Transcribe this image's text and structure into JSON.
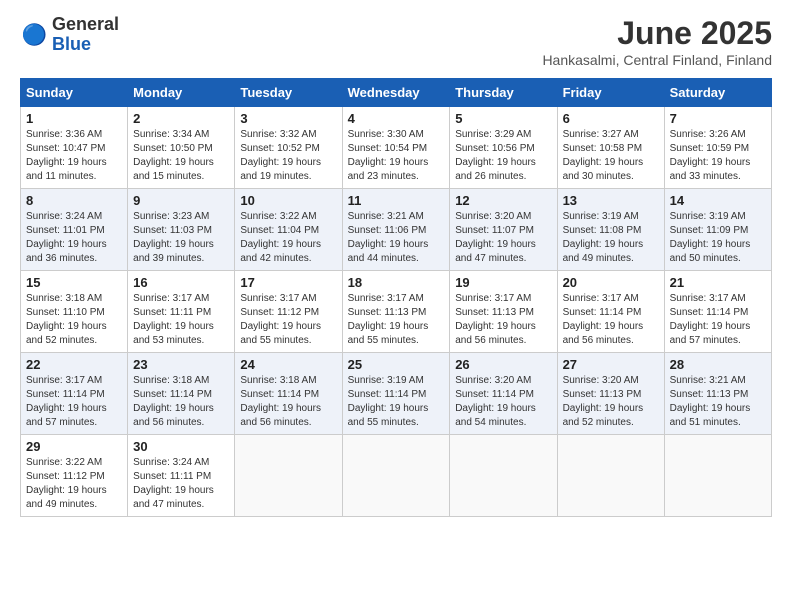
{
  "logo": {
    "general": "General",
    "blue": "Blue"
  },
  "title": "June 2025",
  "location": "Hankasalmi, Central Finland, Finland",
  "weekdays": [
    "Sunday",
    "Monday",
    "Tuesday",
    "Wednesday",
    "Thursday",
    "Friday",
    "Saturday"
  ],
  "weeks": [
    [
      {
        "day": "1",
        "sunrise": "Sunrise: 3:36 AM",
        "sunset": "Sunset: 10:47 PM",
        "daylight": "Daylight: 19 hours and 11 minutes."
      },
      {
        "day": "2",
        "sunrise": "Sunrise: 3:34 AM",
        "sunset": "Sunset: 10:50 PM",
        "daylight": "Daylight: 19 hours and 15 minutes."
      },
      {
        "day": "3",
        "sunrise": "Sunrise: 3:32 AM",
        "sunset": "Sunset: 10:52 PM",
        "daylight": "Daylight: 19 hours and 19 minutes."
      },
      {
        "day": "4",
        "sunrise": "Sunrise: 3:30 AM",
        "sunset": "Sunset: 10:54 PM",
        "daylight": "Daylight: 19 hours and 23 minutes."
      },
      {
        "day": "5",
        "sunrise": "Sunrise: 3:29 AM",
        "sunset": "Sunset: 10:56 PM",
        "daylight": "Daylight: 19 hours and 26 minutes."
      },
      {
        "day": "6",
        "sunrise": "Sunrise: 3:27 AM",
        "sunset": "Sunset: 10:58 PM",
        "daylight": "Daylight: 19 hours and 30 minutes."
      },
      {
        "day": "7",
        "sunrise": "Sunrise: 3:26 AM",
        "sunset": "Sunset: 10:59 PM",
        "daylight": "Daylight: 19 hours and 33 minutes."
      }
    ],
    [
      {
        "day": "8",
        "sunrise": "Sunrise: 3:24 AM",
        "sunset": "Sunset: 11:01 PM",
        "daylight": "Daylight: 19 hours and 36 minutes."
      },
      {
        "day": "9",
        "sunrise": "Sunrise: 3:23 AM",
        "sunset": "Sunset: 11:03 PM",
        "daylight": "Daylight: 19 hours and 39 minutes."
      },
      {
        "day": "10",
        "sunrise": "Sunrise: 3:22 AM",
        "sunset": "Sunset: 11:04 PM",
        "daylight": "Daylight: 19 hours and 42 minutes."
      },
      {
        "day": "11",
        "sunrise": "Sunrise: 3:21 AM",
        "sunset": "Sunset: 11:06 PM",
        "daylight": "Daylight: 19 hours and 44 minutes."
      },
      {
        "day": "12",
        "sunrise": "Sunrise: 3:20 AM",
        "sunset": "Sunset: 11:07 PM",
        "daylight": "Daylight: 19 hours and 47 minutes."
      },
      {
        "day": "13",
        "sunrise": "Sunrise: 3:19 AM",
        "sunset": "Sunset: 11:08 PM",
        "daylight": "Daylight: 19 hours and 49 minutes."
      },
      {
        "day": "14",
        "sunrise": "Sunrise: 3:19 AM",
        "sunset": "Sunset: 11:09 PM",
        "daylight": "Daylight: 19 hours and 50 minutes."
      }
    ],
    [
      {
        "day": "15",
        "sunrise": "Sunrise: 3:18 AM",
        "sunset": "Sunset: 11:10 PM",
        "daylight": "Daylight: 19 hours and 52 minutes."
      },
      {
        "day": "16",
        "sunrise": "Sunrise: 3:17 AM",
        "sunset": "Sunset: 11:11 PM",
        "daylight": "Daylight: 19 hours and 53 minutes."
      },
      {
        "day": "17",
        "sunrise": "Sunrise: 3:17 AM",
        "sunset": "Sunset: 11:12 PM",
        "daylight": "Daylight: 19 hours and 55 minutes."
      },
      {
        "day": "18",
        "sunrise": "Sunrise: 3:17 AM",
        "sunset": "Sunset: 11:13 PM",
        "daylight": "Daylight: 19 hours and 55 minutes."
      },
      {
        "day": "19",
        "sunrise": "Sunrise: 3:17 AM",
        "sunset": "Sunset: 11:13 PM",
        "daylight": "Daylight: 19 hours and 56 minutes."
      },
      {
        "day": "20",
        "sunrise": "Sunrise: 3:17 AM",
        "sunset": "Sunset: 11:14 PM",
        "daylight": "Daylight: 19 hours and 56 minutes."
      },
      {
        "day": "21",
        "sunrise": "Sunrise: 3:17 AM",
        "sunset": "Sunset: 11:14 PM",
        "daylight": "Daylight: 19 hours and 57 minutes."
      }
    ],
    [
      {
        "day": "22",
        "sunrise": "Sunrise: 3:17 AM",
        "sunset": "Sunset: 11:14 PM",
        "daylight": "Daylight: 19 hours and 57 minutes."
      },
      {
        "day": "23",
        "sunrise": "Sunrise: 3:18 AM",
        "sunset": "Sunset: 11:14 PM",
        "daylight": "Daylight: 19 hours and 56 minutes."
      },
      {
        "day": "24",
        "sunrise": "Sunrise: 3:18 AM",
        "sunset": "Sunset: 11:14 PM",
        "daylight": "Daylight: 19 hours and 56 minutes."
      },
      {
        "day": "25",
        "sunrise": "Sunrise: 3:19 AM",
        "sunset": "Sunset: 11:14 PM",
        "daylight": "Daylight: 19 hours and 55 minutes."
      },
      {
        "day": "26",
        "sunrise": "Sunrise: 3:20 AM",
        "sunset": "Sunset: 11:14 PM",
        "daylight": "Daylight: 19 hours and 54 minutes."
      },
      {
        "day": "27",
        "sunrise": "Sunrise: 3:20 AM",
        "sunset": "Sunset: 11:13 PM",
        "daylight": "Daylight: 19 hours and 52 minutes."
      },
      {
        "day": "28",
        "sunrise": "Sunrise: 3:21 AM",
        "sunset": "Sunset: 11:13 PM",
        "daylight": "Daylight: 19 hours and 51 minutes."
      }
    ],
    [
      {
        "day": "29",
        "sunrise": "Sunrise: 3:22 AM",
        "sunset": "Sunset: 11:12 PM",
        "daylight": "Daylight: 19 hours and 49 minutes."
      },
      {
        "day": "30",
        "sunrise": "Sunrise: 3:24 AM",
        "sunset": "Sunset: 11:11 PM",
        "daylight": "Daylight: 19 hours and 47 minutes."
      },
      null,
      null,
      null,
      null,
      null
    ]
  ]
}
